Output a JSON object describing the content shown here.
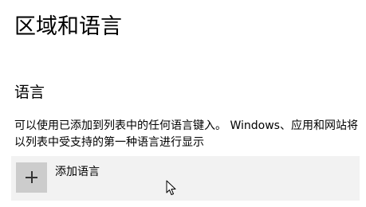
{
  "page": {
    "title": "区域和语言"
  },
  "language_section": {
    "heading": "语言",
    "description": "可以使用已添加到列表中的任何语言键入。 Windows、应用和网站将以列表中受支持的第一种语言进行显示",
    "add_language_label": "添加语言",
    "add_icon": "plus-icon"
  },
  "pointer": {
    "icon": "mouse-cursor-icon"
  }
}
